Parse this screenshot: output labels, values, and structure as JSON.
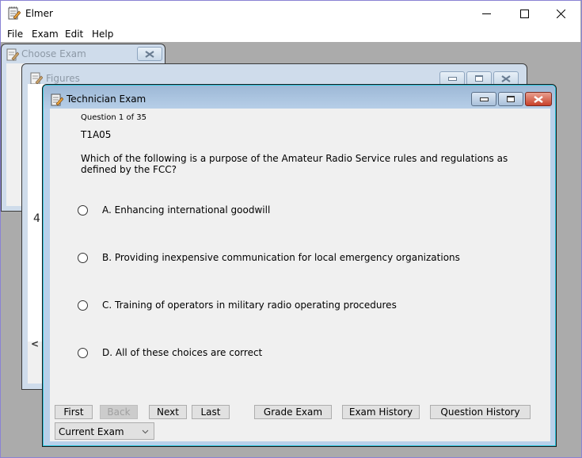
{
  "app": {
    "title": "Elmer",
    "menu": [
      "File",
      "Exam",
      "Edit",
      "Help"
    ],
    "window_controls": {
      "minimize": "—",
      "maximize": "☐",
      "close": "✕"
    }
  },
  "windows": {
    "choose_exam": {
      "title": "Choose Exam"
    },
    "figures": {
      "title": "Figures",
      "visible_text": "4",
      "scroll_left_glyph": "<"
    },
    "technician_exam": {
      "title": "Technician Exam",
      "question_counter": "Question 1 of 35",
      "question_id": "T1A05",
      "question_text": "Which of the following is a purpose of the Amateur Radio Service rules and regulations as defined by the FCC?",
      "answers": [
        {
          "label": "A. Enhancing international goodwill",
          "selected": false
        },
        {
          "label": "B. Providing inexpensive communication for local emergency organizations",
          "selected": false
        },
        {
          "label": "C. Training of operators in military radio operating procedures",
          "selected": false
        },
        {
          "label": "D. All of these choices are correct",
          "selected": false
        }
      ],
      "buttons": {
        "first": "First",
        "back": "Back",
        "next": "Next",
        "last": "Last",
        "grade": "Grade Exam",
        "exam_history": "Exam History",
        "question_history": "Question History"
      },
      "mode_select": {
        "value": "Current Exam"
      }
    }
  }
}
